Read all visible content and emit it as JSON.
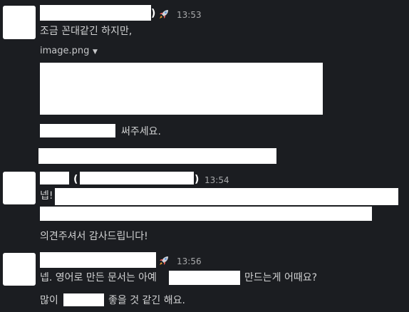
{
  "colors": {
    "background": "#1b1d21",
    "message_text": "#d1d2d3",
    "timestamp": "#a8a9ab",
    "redaction": "#ffffff"
  },
  "messages": [
    {
      "name_suffix": ")",
      "emoji_icon": "rocket-icon",
      "timestamp": "13:53",
      "lines": [
        "조금 꼰대같긴 하지만,"
      ],
      "attachment": {
        "filename": "image.png",
        "caret_icon": "chevron-down-icon"
      },
      "after_attachment": [
        "써주세요."
      ]
    },
    {
      "name_open_paren": "(",
      "name_close_paren": ")",
      "timestamp": "13:54",
      "lines": [
        "넵!",
        "의견주셔서 감사드립니다!"
      ]
    },
    {
      "emoji_icon": "rocket-icon",
      "timestamp": "13:56",
      "lines": [
        {
          "before": "넵. 영어로 만든 문서는 아예",
          "after": "만드는게 어때요?"
        },
        {
          "before": "많이",
          "after": "좋을 것 같긴 해요."
        }
      ]
    }
  ]
}
